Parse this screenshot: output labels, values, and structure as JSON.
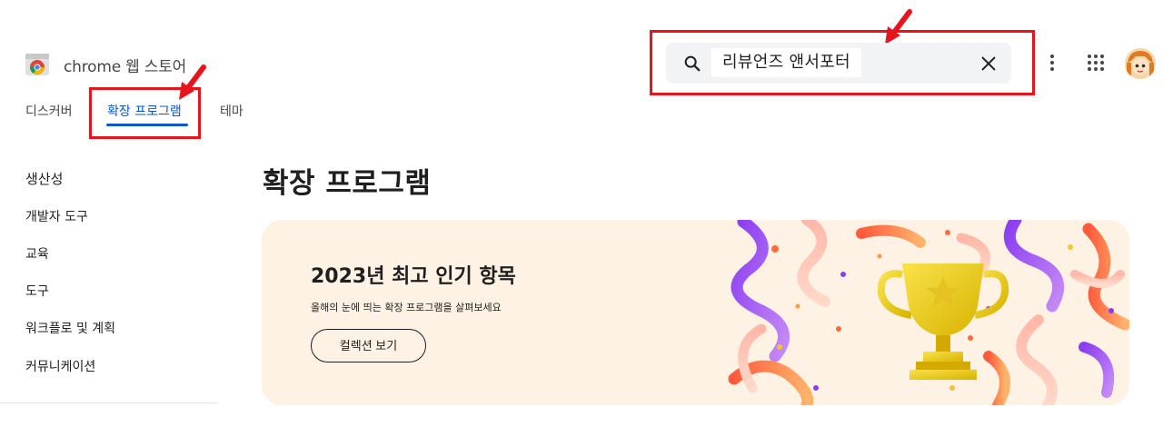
{
  "header": {
    "logo_text": "chrome 웹 스토어",
    "search": {
      "value": "리뷰언즈 앤서포터"
    }
  },
  "tabs": [
    {
      "label": "디스커버",
      "active": false
    },
    {
      "label": "확장 프로그램",
      "active": true
    },
    {
      "label": "테마",
      "active": false
    }
  ],
  "sidebar": {
    "items": [
      {
        "label": "생산성"
      },
      {
        "label": "개발자 도구"
      },
      {
        "label": "교육"
      },
      {
        "label": "도구"
      },
      {
        "label": "워크플로 및 계획"
      },
      {
        "label": "커뮤니케이션"
      }
    ]
  },
  "main": {
    "title": "확장 프로그램",
    "banner": {
      "title": "2023년 최고 인기 항목",
      "subtitle": "올해의 눈에 띄는 확장 프로그램을 살펴보세요",
      "button_label": "컬렉션 보기"
    }
  },
  "colors": {
    "accent": "#0b57d0",
    "highlight_red": "#e8141b",
    "banner_bg": "#fdf2e3",
    "search_bg": "#f1f3f4"
  },
  "icons": [
    "chrome-logo-icon",
    "search-icon",
    "close-icon",
    "more-vert-icon",
    "apps-grid-icon",
    "trophy-illustration"
  ]
}
